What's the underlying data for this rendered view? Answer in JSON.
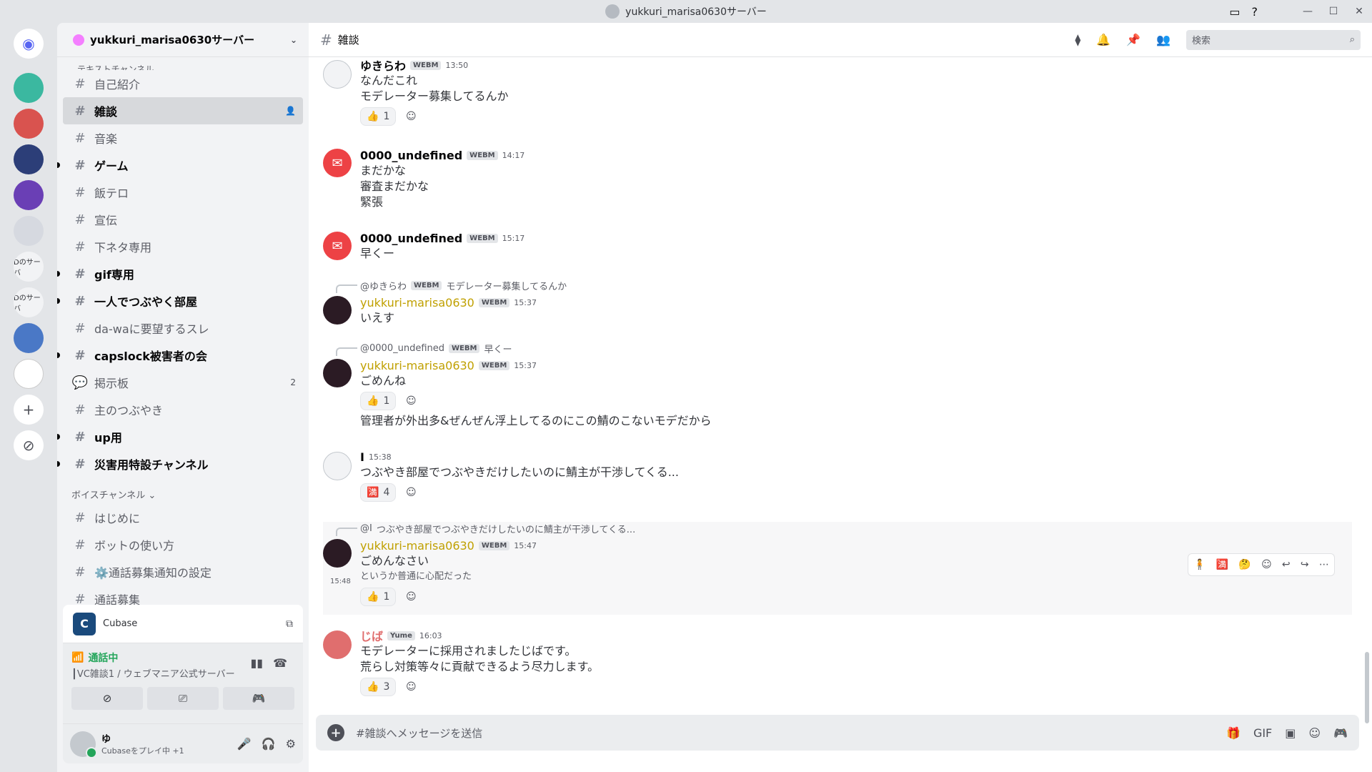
{
  "window": {
    "title": "yukkuri_marisa0630サーバー",
    "controls": [
      "inbox-icon",
      "help-icon",
      "minimize-icon",
      "maximize-icon",
      "close-icon"
    ]
  },
  "servers": {
    "labels": [
      "Dのサーバ",
      "Dのサーバ"
    ]
  },
  "guild": {
    "name": "yukkuri_marisa0630サーバー"
  },
  "channels": {
    "top_cut": "テキストチャンネル",
    "list": [
      {
        "name": "自己紹介",
        "state": "normal"
      },
      {
        "name": "雑談",
        "state": "active"
      },
      {
        "name": "音楽",
        "state": "normal"
      },
      {
        "name": "ゲーム",
        "state": "unread"
      },
      {
        "name": "飯テロ",
        "state": "normal"
      },
      {
        "name": "宣伝",
        "state": "normal"
      },
      {
        "name": "下ネタ専用",
        "state": "normal"
      },
      {
        "name": "gif専用",
        "state": "unread"
      },
      {
        "name": "一人でつぶやく部屋",
        "state": "unread"
      },
      {
        "name": "da-waに要望するスレ",
        "state": "normal"
      },
      {
        "name": "capslock被害者の会",
        "state": "unread"
      },
      {
        "name": "掲示板",
        "state": "forum",
        "count": "2"
      },
      {
        "name": "主のつぶやき",
        "state": "normal"
      },
      {
        "name": "up用",
        "state": "unread"
      },
      {
        "name": "災害用特設チャンネル",
        "state": "unread"
      }
    ],
    "voice_category": "ボイスチャンネル",
    "voice_list": [
      "はじめに",
      "ボットの使い方",
      "⚙️通話募集通知の設定",
      "通話募集"
    ]
  },
  "panel": {
    "activity_app": "Cubase",
    "voice_status": "通話中",
    "voice_channel": "┃VC雑談1 / ウェブマニア公式サーバー",
    "user_name": "ゆ",
    "user_status": "Cubaseをプレイ中 +1"
  },
  "channel_header": {
    "name": "雑談",
    "search_placeholder": "検索"
  },
  "messages": [
    {
      "author": "ゆきらわ",
      "tag": "WEBM",
      "time": "13:50",
      "lines": [
        "なんだこれ",
        "モデレーター募集してるんか"
      ],
      "reaction": {
        "emoji": "👍",
        "count": "1"
      }
    },
    {
      "author": "0000_undefined",
      "tag": "WEBM",
      "time": "14:17",
      "lines": [
        "まだかな",
        "審査まだかな",
        "緊張"
      ]
    },
    {
      "author": "0000_undefined",
      "tag": "WEBM",
      "time": "15:17",
      "lines": [
        "早くー"
      ]
    },
    {
      "reply_to": "@ゆきらわ",
      "reply_tag": "WEBM",
      "reply_text": "モデレーター募集してるんか",
      "author": "yukkuri-marisa0630",
      "tag": "WEBM",
      "time": "15:37",
      "lines": [
        "いえす"
      ]
    },
    {
      "reply_to": "@0000_undefined",
      "reply_tag": "WEBM",
      "reply_text": "早くー",
      "author": "yukkuri-marisa0630",
      "tag": "WEBM",
      "time": "15:37",
      "lines": [
        "ごめんね"
      ],
      "reaction": {
        "emoji": "👍",
        "count": "1"
      },
      "extra": "管理者が外出多&ぜんぜん浮上してるのにこの鯖のこないモデだから"
    },
    {
      "author": "I",
      "time": "15:38",
      "lines": [
        "つぶやき部屋でつぶやきだけしたいのに鯖主が干渉してくる..."
      ],
      "reaction": {
        "emoji": "🈵",
        "count": "4"
      }
    },
    {
      "reply_to": "@I",
      "reply_text": "つぶやき部屋でつぶやきだけしたいのに鯖主が干渉してくる...",
      "author": "yukkuri-marisa0630",
      "tag": "WEBM",
      "time": "15:47",
      "lines": [
        "ごめんなさい"
      ],
      "followup_time": "15:48",
      "followup": "というか普通に心配だった",
      "reaction": {
        "emoji": "👍",
        "count": "1"
      }
    },
    {
      "author": "じば",
      "tag": "Yume",
      "time": "16:03",
      "lines": [
        "モデレーターに採用されましたじばです。",
        "荒らし対策等々に貢献できるよう尽力します。"
      ],
      "reaction": {
        "emoji": "👍",
        "count": "3"
      }
    }
  ],
  "composer": {
    "placeholder": "#雑談へメッセージを送信"
  },
  "colors": {
    "accent": "#5865f2",
    "online": "#23a55a",
    "mention_name": "#c0a000"
  }
}
